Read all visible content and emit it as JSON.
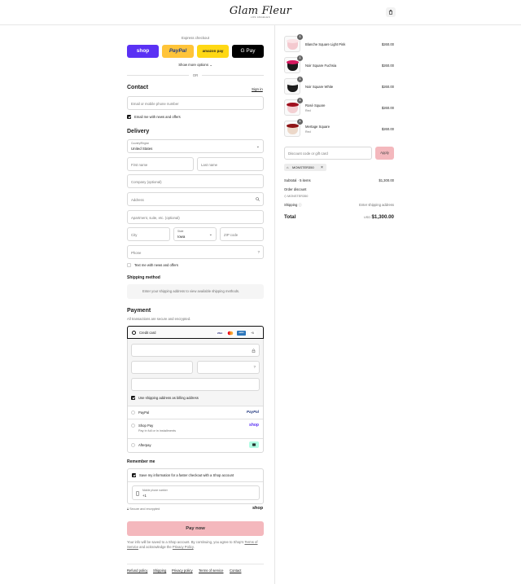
{
  "header": {
    "logo": "Glam Fleur",
    "logo_sub": "LOS ANGELES",
    "cart_icon": "shopping-bag-icon"
  },
  "express": {
    "title": "Express checkout",
    "buttons": [
      "shop",
      "PayPal",
      "amazon pay",
      "G Pay"
    ],
    "show_more": "Show more options",
    "or": "OR"
  },
  "contact": {
    "heading": "Contact",
    "sign_in": "Sign in",
    "email_placeholder": "Email or mobile phone number",
    "email_news": "Email me with news and offers"
  },
  "delivery": {
    "heading": "Delivery",
    "country_label": "Country/Region",
    "country_value": "United States",
    "first_name": "First name",
    "last_name": "Last name",
    "company": "Company (optional)",
    "address": "Address",
    "apartment": "Apartment, suite, etc. (optional)",
    "city": "City",
    "state_label": "State",
    "state_value": "Iowa",
    "zip": "ZIP code",
    "phone": "Phone",
    "text_news": "Text me with news and offers"
  },
  "shipping": {
    "heading": "Shipping method",
    "notice": "Enter your shipping address to view available shipping methods."
  },
  "payment": {
    "heading": "Payment",
    "subtitle": "All transactions are secure and encrypted.",
    "credit_card": "Credit card",
    "card_brands": [
      "VISA",
      "MC",
      "AMEX",
      "+5"
    ],
    "billing_same": "Use shipping address as billing address",
    "paypal": "PayPal",
    "paypal_logo": "PayPal",
    "shop_pay": "Shop Pay",
    "shop_pay_sub": "Pay in full or in installments",
    "shop_pay_logo": "shop",
    "afterpay": "Afterpay"
  },
  "remember": {
    "heading": "Remember me",
    "save_info": "Save my information for a faster checkout with a Shop account",
    "mobile_label": "Mobile phone number",
    "mobile_value": "+1",
    "secure": "Secure and encrypted",
    "shop_logo": "shop"
  },
  "pay_button": "Pay now",
  "legal": {
    "line1": "Your info will be saved to a Shop account. By continuing, you agree to Shop's",
    "terms": "Terms of Service",
    "and": "and acknowledge the",
    "privacy": "Privacy Policy",
    "period": "."
  },
  "footer_links": [
    "Refund policy",
    "Shipping",
    "Privacy policy",
    "Terms of service",
    "Contact"
  ],
  "summary": {
    "items": [
      {
        "name": "Blanche Square Light Pink",
        "variant": "",
        "price": "$260.00",
        "qty": "1",
        "color": "#f4c9cf",
        "top": "#fbe3e6"
      },
      {
        "name": "Noir Square Fuchsia",
        "variant": "",
        "price": "$260.00",
        "qty": "1",
        "color": "#1b1b1b",
        "top": "#d6185f"
      },
      {
        "name": "Noir Square White",
        "variant": "",
        "price": "$260.00",
        "qty": "1",
        "color": "#1b1b1b",
        "top": "#f4f4f4"
      },
      {
        "name": "Rosé Square",
        "variant": "Red",
        "price": "$260.00",
        "qty": "1",
        "color": "#f3d0d3",
        "top": "#a0101e"
      },
      {
        "name": "Mertage Square",
        "variant": "Red",
        "price": "$260.00",
        "qty": "1",
        "color": "#ecd8c9",
        "top": "#8e1416"
      }
    ],
    "discount_placeholder": "Discount code or gift card",
    "apply": "Apply",
    "code_tag": "MONSTER350",
    "subtotal_label": "Subtotal · 5 items",
    "subtotal_value": "$1,300.00",
    "order_discount": "Order discount",
    "discount_code": "MONSTER350",
    "shipping_label": "Shipping",
    "shipping_value": "Enter shipping address",
    "total_label": "Total",
    "currency": "USD",
    "total_value": "$1,300.00"
  },
  "colors": {
    "shop": "#5a31f4",
    "paypal": "#ffc439",
    "amazon": "#ffd814",
    "gpay": "#000000",
    "pay_now": "#f4b8bd",
    "apply": "#f4b8bd"
  }
}
